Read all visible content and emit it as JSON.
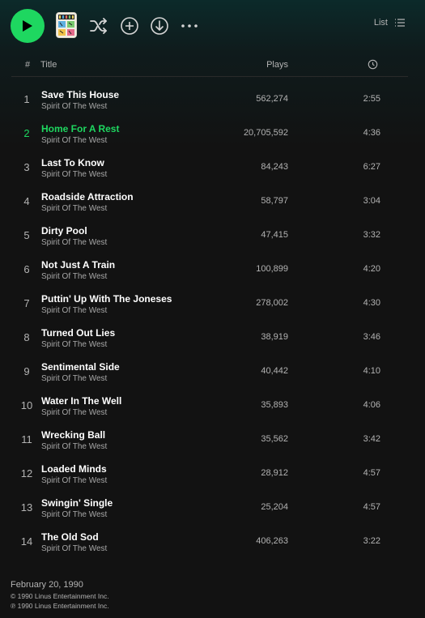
{
  "toolbar": {
    "view_label": "List"
  },
  "header": {
    "num": "#",
    "title": "Title",
    "plays": "Plays"
  },
  "tracks": [
    {
      "num": "1",
      "title": "Save This House",
      "artist": "Spirit Of The West",
      "plays": "562,274",
      "duration": "2:55",
      "active": false
    },
    {
      "num": "2",
      "title": "Home For A Rest",
      "artist": "Spirit Of The West",
      "plays": "20,705,592",
      "duration": "4:36",
      "active": true
    },
    {
      "num": "3",
      "title": "Last To Know",
      "artist": "Spirit Of The West",
      "plays": "84,243",
      "duration": "6:27",
      "active": false
    },
    {
      "num": "4",
      "title": "Roadside Attraction",
      "artist": "Spirit Of The West",
      "plays": "58,797",
      "duration": "3:04",
      "active": false
    },
    {
      "num": "5",
      "title": "Dirty Pool",
      "artist": "Spirit Of The West",
      "plays": "47,415",
      "duration": "3:32",
      "active": false
    },
    {
      "num": "6",
      "title": "Not Just A Train",
      "artist": "Spirit Of The West",
      "plays": "100,899",
      "duration": "4:20",
      "active": false
    },
    {
      "num": "7",
      "title": "Puttin' Up With The Joneses",
      "artist": "Spirit Of The West",
      "plays": "278,002",
      "duration": "4:30",
      "active": false
    },
    {
      "num": "8",
      "title": "Turned Out Lies",
      "artist": "Spirit Of The West",
      "plays": "38,919",
      "duration": "3:46",
      "active": false
    },
    {
      "num": "9",
      "title": "Sentimental Side",
      "artist": "Spirit Of The West",
      "plays": "40,442",
      "duration": "4:10",
      "active": false
    },
    {
      "num": "10",
      "title": "Water In The Well",
      "artist": "Spirit Of The West",
      "plays": "35,893",
      "duration": "4:06",
      "active": false
    },
    {
      "num": "11",
      "title": "Wrecking Ball",
      "artist": "Spirit Of The West",
      "plays": "35,562",
      "duration": "3:42",
      "active": false
    },
    {
      "num": "12",
      "title": "Loaded Minds",
      "artist": "Spirit Of The West",
      "plays": "28,912",
      "duration": "4:57",
      "active": false
    },
    {
      "num": "13",
      "title": "Swingin' Single",
      "artist": "Spirit Of The West",
      "plays": "25,204",
      "duration": "4:57",
      "active": false
    },
    {
      "num": "14",
      "title": "The Old Sod",
      "artist": "Spirit Of The West",
      "plays": "406,263",
      "duration": "3:22",
      "active": false
    }
  ],
  "footer": {
    "release_date": "February 20, 1990",
    "copyright": "© 1990 Linus Entertainment Inc.",
    "phonographic": "℗ 1990 Linus Entertainment Inc."
  },
  "colors": {
    "accent": "#1ed760",
    "background": "#121212",
    "header_gradient": "#0c2a2a"
  },
  "icons": {
    "play": "play-icon",
    "shuffle": "shuffle-icon",
    "add": "add-circle-icon",
    "download": "download-icon",
    "more": "more-icon",
    "list_view": "list-view-icon",
    "duration": "clock-icon"
  }
}
